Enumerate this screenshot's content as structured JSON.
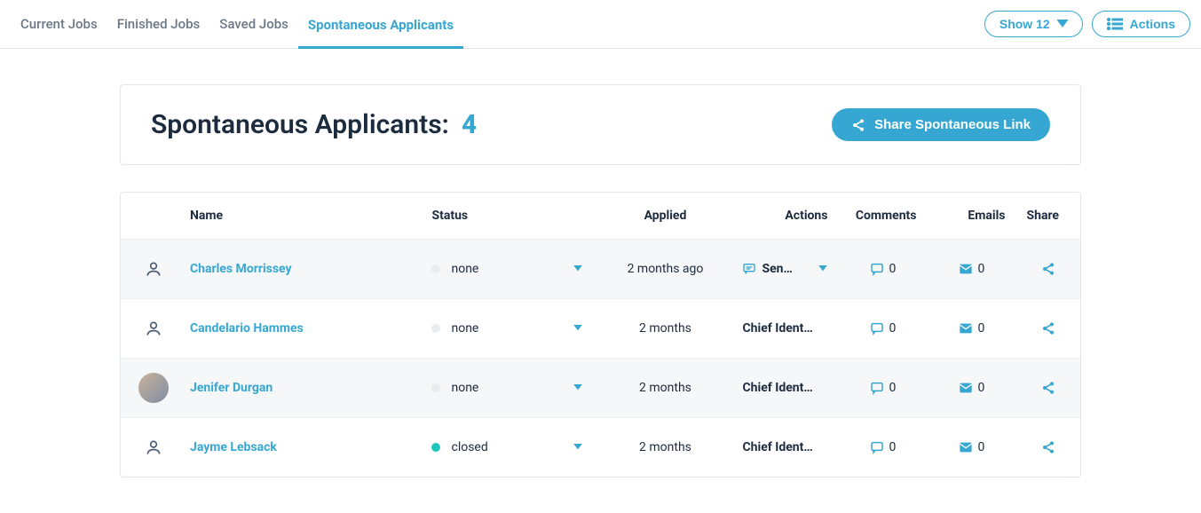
{
  "tabs": [
    {
      "label": "Current Jobs",
      "active": false
    },
    {
      "label": "Finished Jobs",
      "active": false
    },
    {
      "label": "Saved Jobs",
      "active": false
    },
    {
      "label": "Spontaneous Applicants",
      "active": true
    }
  ],
  "topbar": {
    "show_label": "Show 12",
    "actions_label": "Actions"
  },
  "header": {
    "title": "Spontaneous Applicants:",
    "count": "4",
    "share_button": "Share Spontaneous Link"
  },
  "table": {
    "headers": {
      "name": "Name",
      "status": "Status",
      "applied": "Applied",
      "actions": "Actions",
      "comments": "Comments",
      "emails": "Emails",
      "share": "Share"
    },
    "rows": [
      {
        "avatar": "icon",
        "name": "Charles Morrissey",
        "status_text": "none",
        "status_kind": "none",
        "applied": "2 months ago",
        "action_kind": "send",
        "action_text": "Sen…",
        "comments": "0",
        "emails": "0",
        "new": true
      },
      {
        "avatar": "icon",
        "name": "Candelario Hammes",
        "status_text": "none",
        "status_kind": "none",
        "applied": "2 months",
        "action_kind": "text",
        "action_text": "Chief Ident…",
        "comments": "0",
        "emails": "0",
        "new": false
      },
      {
        "avatar": "image",
        "name": "Jenifer Durgan",
        "status_text": "none",
        "status_kind": "none",
        "applied": "2 months",
        "action_kind": "text",
        "action_text": "Chief Ident…",
        "comments": "0",
        "emails": "0",
        "new": true
      },
      {
        "avatar": "icon",
        "name": "Jayme Lebsack",
        "status_text": "closed",
        "status_kind": "closed",
        "applied": "2 months",
        "action_kind": "text",
        "action_text": "Chief Ident…",
        "comments": "0",
        "emails": "0",
        "new": false
      }
    ]
  },
  "icons": {
    "caret_down": "▼"
  }
}
